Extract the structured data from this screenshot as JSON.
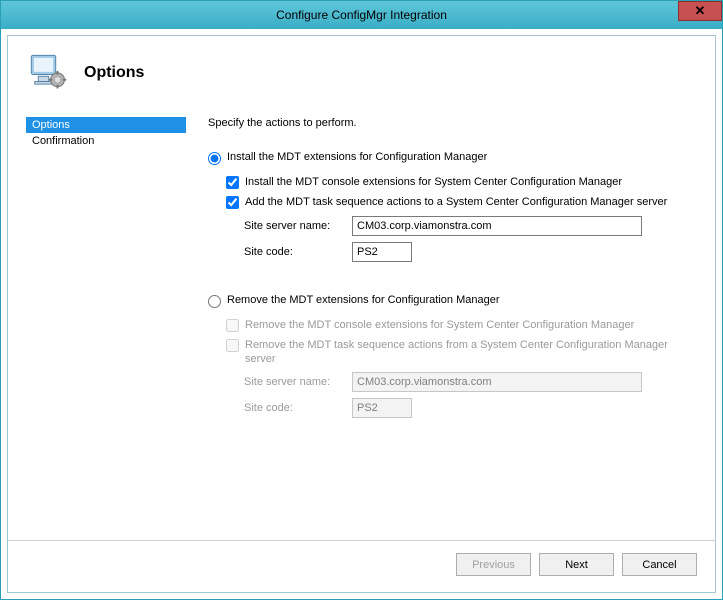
{
  "window": {
    "title": "Configure ConfigMgr Integration"
  },
  "header": {
    "title": "Options"
  },
  "sidebar": {
    "items": [
      {
        "label": "Options",
        "selected": true
      },
      {
        "label": "Confirmation",
        "selected": false
      }
    ]
  },
  "main": {
    "instruction": "Specify the actions to perform.",
    "install": {
      "radio_label": "Install the MDT extensions for Configuration Manager",
      "selected": true,
      "check_console_label": "Install the MDT console extensions for System Center Configuration Manager",
      "check_console_checked": true,
      "check_task_label": "Add the MDT task sequence actions to a System Center Configuration Manager server",
      "check_task_checked": true,
      "site_server_label": "Site server name:",
      "site_server_value": "CM03.corp.viamonstra.com",
      "site_code_label": "Site code:",
      "site_code_value": "PS2"
    },
    "remove": {
      "radio_label": "Remove the MDT extensions for Configuration Manager",
      "selected": false,
      "check_console_label": "Remove the MDT console extensions for System Center Configuration Manager",
      "check_console_checked": false,
      "check_task_label": "Remove the MDT task sequence actions from a System Center Configuration Manager server",
      "check_task_checked": false,
      "site_server_label": "Site server name:",
      "site_server_value": "CM03.corp.viamonstra.com",
      "site_code_label": "Site code:",
      "site_code_value": "PS2"
    }
  },
  "footer": {
    "previous": "Previous",
    "next": "Next",
    "cancel": "Cancel"
  }
}
